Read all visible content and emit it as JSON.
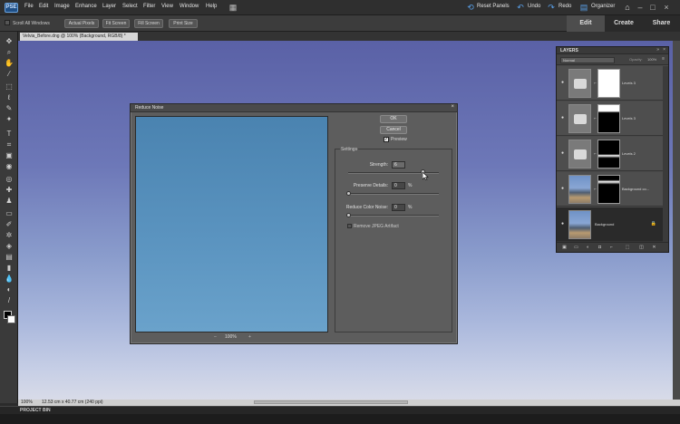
{
  "app": {
    "logo": "PSE"
  },
  "menu": [
    "File",
    "Edit",
    "Image",
    "Enhance",
    "Layer",
    "Select",
    "Filter",
    "View",
    "Window",
    "Help"
  ],
  "top_actions": {
    "reset_panels": "Reset Panels",
    "undo": "Undo",
    "redo": "Redo",
    "organizer": "Organizer"
  },
  "modes": {
    "edit": "Edit",
    "create": "Create",
    "share": "Share"
  },
  "options_bar": {
    "scroll_all_windows": "Scroll All Windows",
    "buttons": [
      "Actual Pixels",
      "Fit Screen",
      "Fill Screen",
      "Print Size"
    ]
  },
  "document_tab": "Velvia_Before.dng @ 100% (Background, RGB/8) *",
  "status": {
    "zoom": "100%",
    "dims": "12.53 cm x 40.77 cm (240 ppi)"
  },
  "project_bin": "PROJECT BIN",
  "dialog": {
    "title": "Reduce Noise",
    "ok": "OK",
    "cancel": "Cancel",
    "preview_label": "Preview",
    "preview_checked": true,
    "settings_label": "Settings",
    "strength_label": "Strength:",
    "strength_value": "6",
    "preserve_details_label": "Preserve Details:",
    "preserve_details_value": "0",
    "reduce_color_noise_label": "Reduce Color Noise:",
    "reduce_color_noise_value": "0",
    "percent": "%",
    "jpeg_label": "Remove JPEG Artifact",
    "zoom": "100%",
    "zoom_minus": "–",
    "zoom_plus": "+"
  },
  "layers_panel": {
    "title": "LAYERS",
    "blend_mode": "Normal",
    "opacity_label": "Opacity:",
    "opacity_value": "100%",
    "layers": [
      {
        "name": "Levels 3",
        "type": "adjustment",
        "mask": "white"
      },
      {
        "name": "Levels 3",
        "type": "adjustment",
        "mask": "dark-top"
      },
      {
        "name": "Levels 2",
        "type": "adjustment",
        "mask": "dark-bottom"
      },
      {
        "name": "Background co...",
        "type": "photo",
        "mask": "dark-top-light"
      },
      {
        "name": "Background",
        "type": "photo",
        "locked": true,
        "active": true
      }
    ],
    "lock_icon": "lock-icon"
  },
  "colors": {
    "dialog_bg": "#5d5d5d",
    "preview_sky": "#5a93bf",
    "canvas_sky": "#6d78b8",
    "accent_blue": "#5aa0e8"
  }
}
